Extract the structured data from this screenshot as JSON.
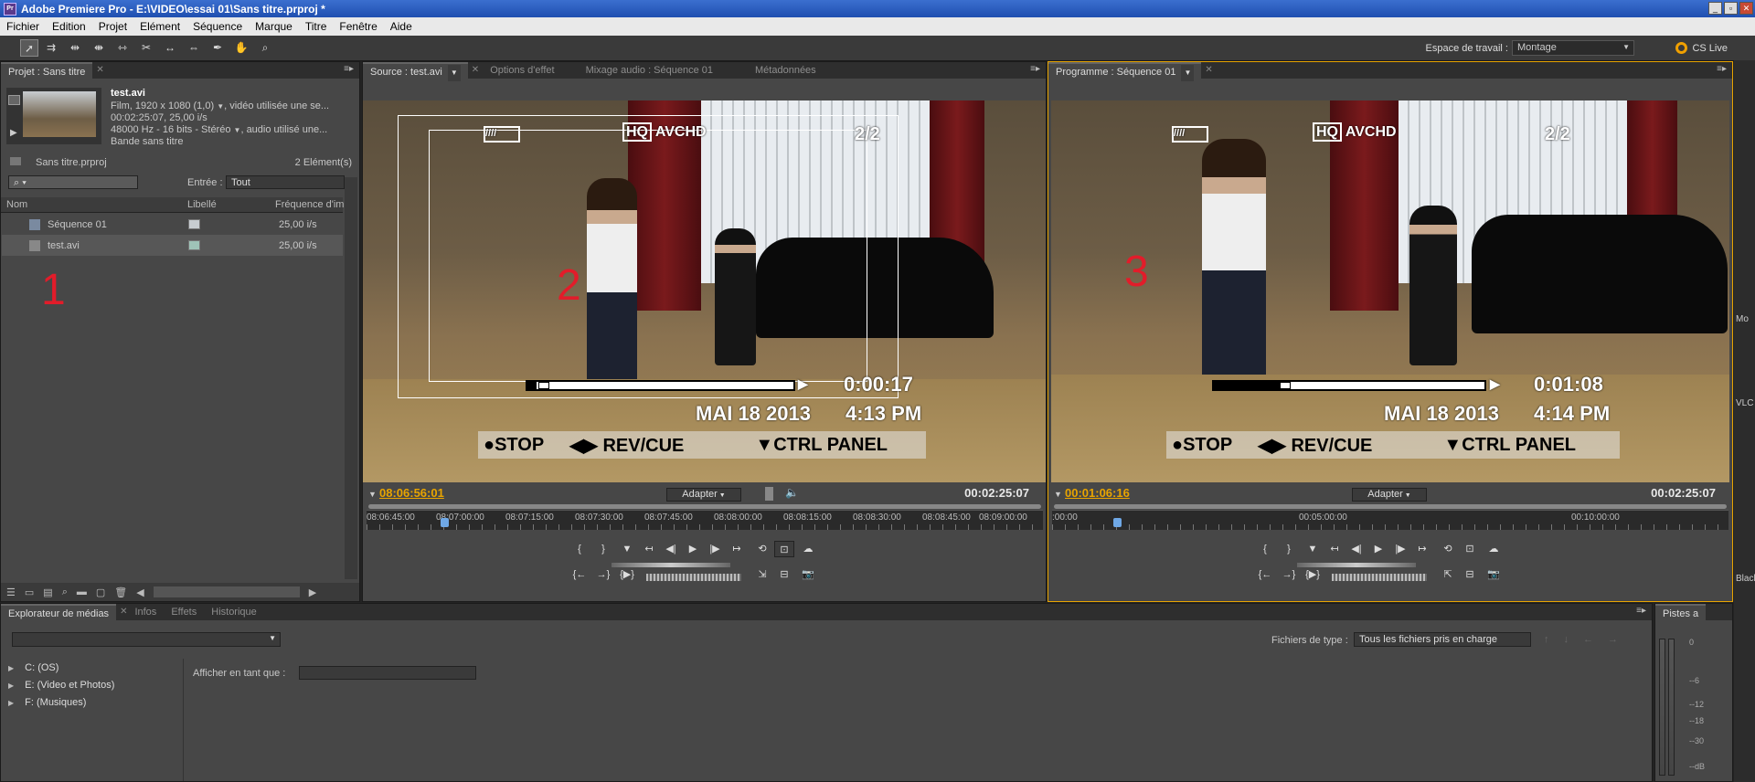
{
  "app": {
    "title": "Adobe Premiere Pro - E:\\VIDEO\\essai 01\\Sans titre.prproj *"
  },
  "window": {
    "minimize": "_",
    "restore": "▫",
    "close": "✕"
  },
  "menu": [
    "Fichier",
    "Edition",
    "Projet",
    "Elément",
    "Séquence",
    "Marque",
    "Titre",
    "Fenêtre",
    "Aide"
  ],
  "toolbar": {
    "tools": [
      "selection-tool",
      "track-select-tool",
      "ripple-edit-tool",
      "rolling-edit-tool",
      "rate-stretch-tool",
      "razor-tool",
      "slip-tool",
      "slide-tool",
      "pen-tool",
      "hand-tool",
      "zoom-tool"
    ],
    "workspace_label": "Espace de travail :",
    "workspace_value": "Montage",
    "cslive": "CS Live"
  },
  "project": {
    "tab": "Projet : Sans titre",
    "clip_name": "test.avi",
    "clip_info1": "Film, 1920 x 1080 (1,0)",
    "clip_info1b": ", vidéo utilisée une se...",
    "clip_info2": "00:02:25:07, 25,00 i/s",
    "clip_info3": "48000 Hz - 16  bits - Stéréo",
    "clip_info3b": ", audio utilisé une...",
    "clip_info4": "Bande sans titre",
    "project_file": "Sans titre.prproj",
    "count": "2 Elément(s)",
    "search_placeholder": "",
    "entry_label": "Entrée :",
    "entry_value": "Tout",
    "columns": [
      "Nom",
      "Libellé",
      "Fréquence d'im"
    ],
    "items": [
      {
        "name": "Séquence 01",
        "color": "#c8cdd1",
        "fps": "25,00 i/s"
      },
      {
        "name": "test.avi",
        "color": "#9fc3b8",
        "fps": "25,00 i/s"
      }
    ],
    "annotation": "1"
  },
  "source": {
    "tabs": [
      "Source : test.avi",
      "Options d'effet",
      "Mixage audio : Séquence 01",
      "Métadonnées"
    ],
    "timecode": "08:06:56:01",
    "fit": "Adapter",
    "duration": "00:02:25:07",
    "ruler": [
      "08:06:45:00",
      "08:07:00:00",
      "08:07:15:00",
      "08:07:30:00",
      "08:07:45:00",
      "08:08:00:00",
      "08:08:15:00",
      "08:08:30:00",
      "08:08:45:00",
      "08:09:00:00"
    ],
    "playhead_fraction": 0.11,
    "osd_time": "0:00:17",
    "osd_date": "MAI 18 2013",
    "osd_clock": "4:13  PM",
    "annotation": "2"
  },
  "program": {
    "tab": "Programme : Séquence 01",
    "timecode": "00:01:06:16",
    "fit": "Adapter",
    "duration": "00:02:25:07",
    "ruler": [
      ":00:00",
      "00:05:00:00",
      "00:10:00:00"
    ],
    "playhead_fraction": 0.09,
    "osd_time": "0:01:08",
    "osd_date": "MAI 18 2013",
    "osd_clock": "4:14  PM",
    "annotation": "3"
  },
  "osd": {
    "hq": "HQ",
    "avchd": "AVCHD",
    "count": "2/2",
    "stop": "●STOP",
    "rev": "◀▶ REV/CUE",
    "ctrl": "▼CTRL PANEL"
  },
  "browser": {
    "tabs": [
      "Explorateur de médias",
      "Infos",
      "Effets",
      "Historique"
    ],
    "file_type_label": "Fichiers de type :",
    "file_type_value": "Tous les fichiers pris en charge",
    "show_as_label": "Afficher en tant que :",
    "drives": [
      "C: (OS)",
      "E: (Video et Photos)",
      "F: (Musiques)"
    ]
  },
  "meters": {
    "tab": "Pistes a",
    "labels": [
      "0",
      "--6",
      "--12",
      "--18",
      "--30",
      "--dB"
    ]
  },
  "rightstrip": [
    "Mo",
    "VLC",
    "Black"
  ]
}
